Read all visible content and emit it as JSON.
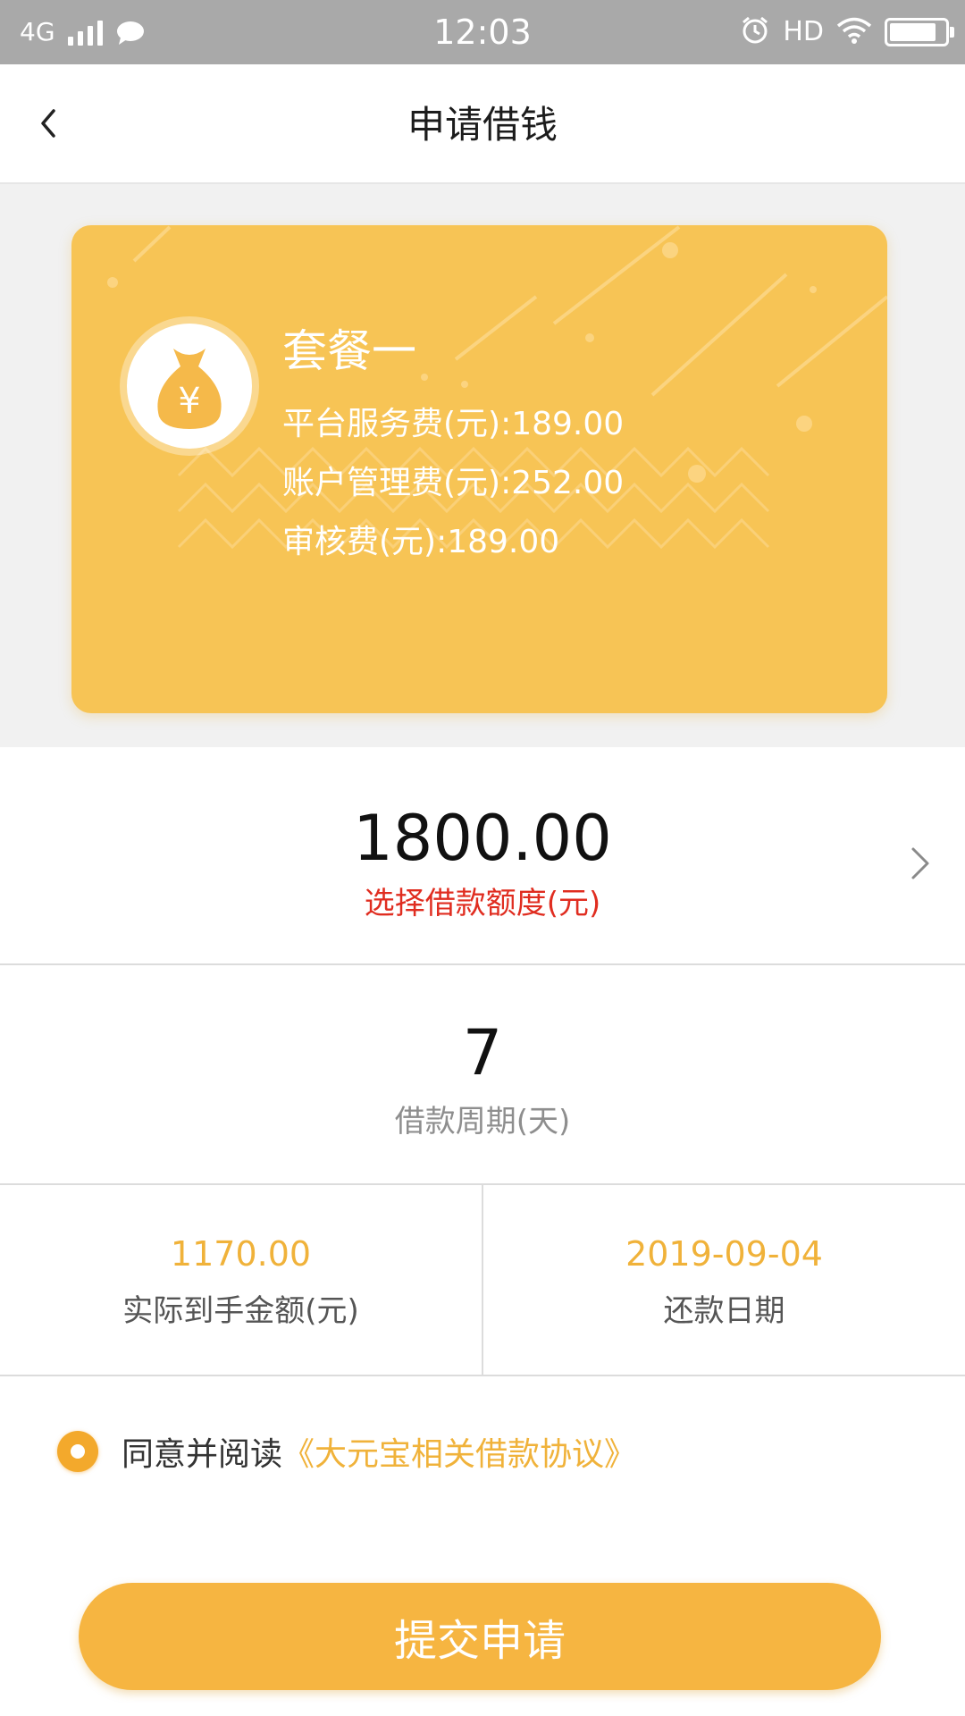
{
  "status_bar": {
    "network": "4G",
    "time": "12:03",
    "hd": "HD",
    "battery_level": 0.95
  },
  "nav": {
    "title": "申请借钱"
  },
  "package": {
    "title": "套餐一",
    "fees": [
      {
        "text": "平台服务费(元):189.00"
      },
      {
        "text": "账户管理费(元):252.00"
      },
      {
        "text": "审核费(元):189.00"
      }
    ],
    "icon": "money-bag-icon",
    "icon_symbol": "¥"
  },
  "amount": {
    "value": "1800.00",
    "label": "选择借款额度(元)"
  },
  "period": {
    "value": "7",
    "label": "借款周期(天)"
  },
  "info": {
    "received": {
      "value": "1170.00",
      "label": "实际到手金额(元)"
    },
    "repay_date": {
      "value": "2019-09-04",
      "label": "还款日期"
    }
  },
  "agreement": {
    "prefix": "同意并阅读",
    "link": "《大元宝相关借款协议》",
    "checked": true
  },
  "submit": {
    "label": "提交申请"
  },
  "colors": {
    "accent": "#f6b541",
    "card": "#f7c455",
    "warning_text": "#e02d20",
    "status_bar": "#a9a9a9"
  }
}
